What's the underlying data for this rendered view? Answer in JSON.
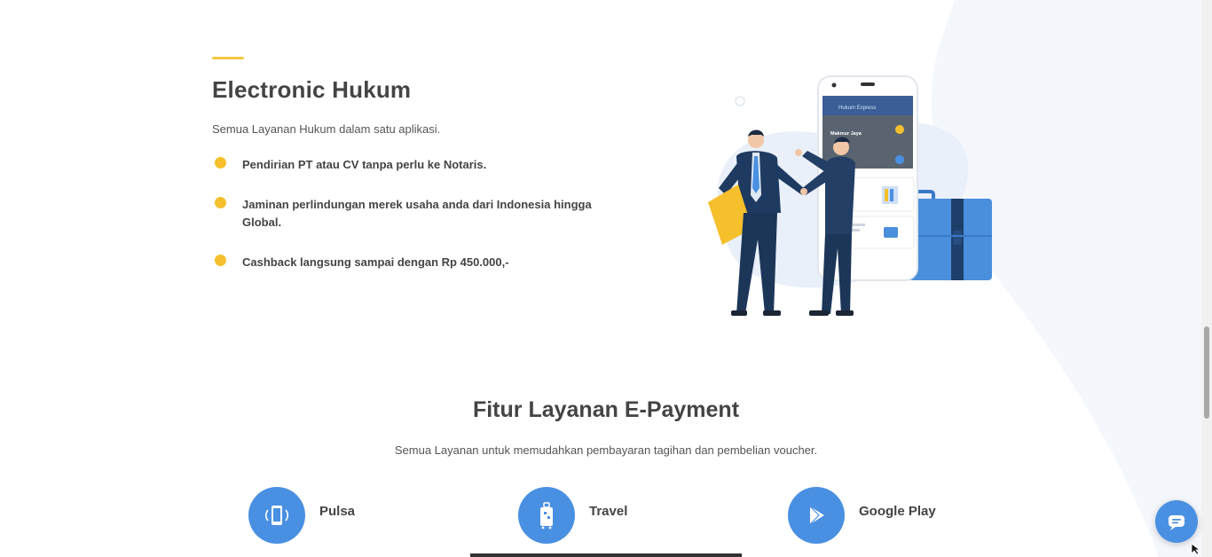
{
  "hukum": {
    "title": "Electronic Hukum",
    "subtitle": "Semua Layanan Hukum dalam satu aplikasi.",
    "features": [
      "Pendirian PT atau CV tanpa perlu ke Notaris.",
      "Jaminan perlindungan merek usaha anda dari Indonesia hingga Global.",
      "Cashback langsung sampai dengan Rp 450.000,-"
    ],
    "illustration": {
      "app_header": "Hukum Express",
      "company_name": "Makmur Jaya"
    }
  },
  "payment": {
    "title": "Fitur Layanan E-Payment",
    "subtitle": "Semua Layanan untuk memudahkan pembayaran tagihan dan pembelian voucher.",
    "items": [
      {
        "label": "Pulsa",
        "icon": "phone-signal-icon"
      },
      {
        "label": "Travel",
        "icon": "luggage-icon"
      },
      {
        "label": "Google Play",
        "icon": "play-store-icon"
      }
    ],
    "active_index": 1
  },
  "colors": {
    "accent": "#f5c842",
    "bullet": "#f5c02c",
    "primary_blue": "#4a90e2",
    "text": "#444444"
  }
}
